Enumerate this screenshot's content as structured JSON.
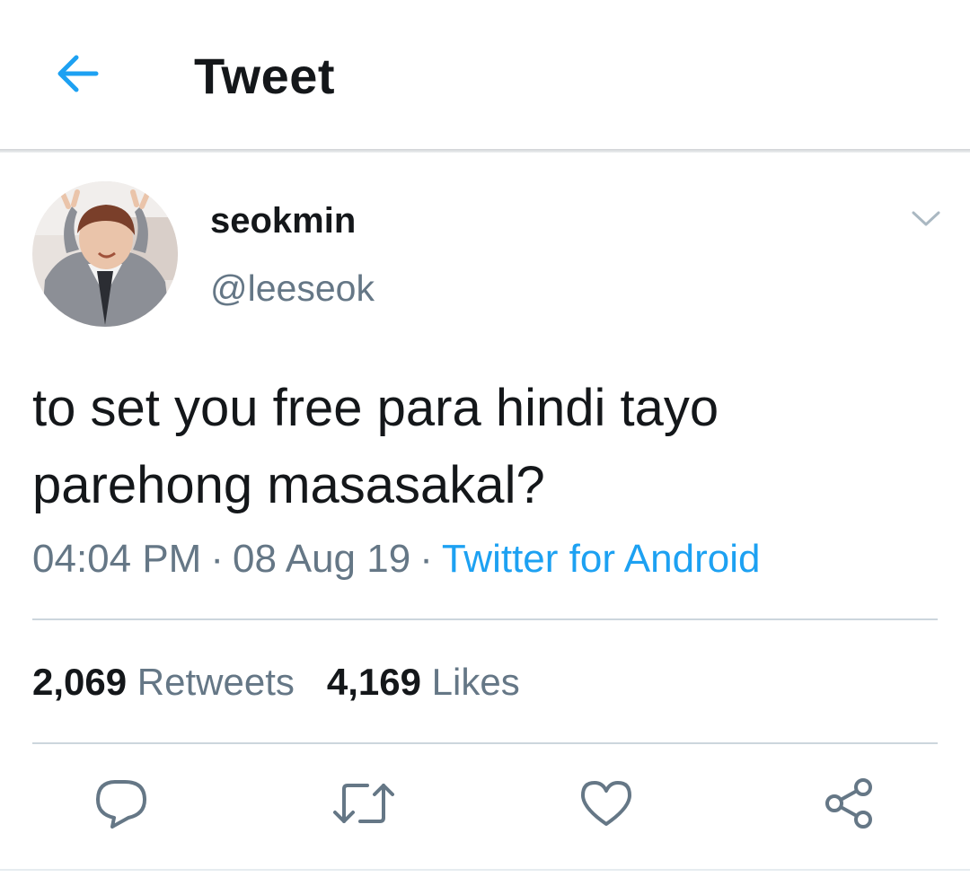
{
  "header": {
    "title": "Tweet",
    "back_icon": "arrow-left-icon",
    "accent": "#1da1f2"
  },
  "tweet": {
    "display_name": "seokmin",
    "handle": "@leeseok",
    "text_line1": "to set you free para hindi tayo",
    "text_line2": "parehong masasakal?",
    "time": "04:04 PM",
    "date": "08 Aug 19",
    "separator": "·",
    "source": "Twitter for Android",
    "retweets_count": "2,069",
    "retweets_label": "Retweets",
    "likes_count": "4,169",
    "likes_label": "Likes"
  },
  "actions": [
    "reply-icon",
    "retweet-icon",
    "like-icon",
    "share-icon"
  ],
  "colors": {
    "text": "#14171a",
    "secondary": "#657786",
    "link": "#1da1f2",
    "icon": "#657786"
  }
}
